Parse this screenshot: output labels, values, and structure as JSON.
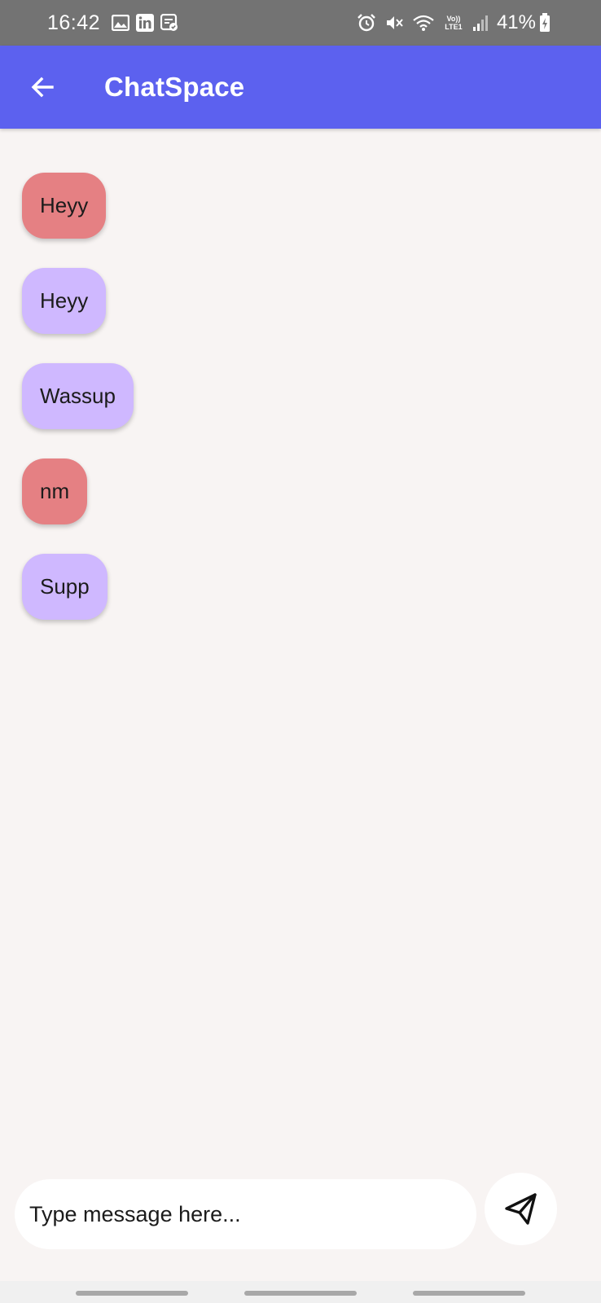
{
  "status_bar": {
    "time": "16:42",
    "battery_percent": "41%",
    "left_icons": [
      "gallery-icon",
      "linkedin-icon",
      "notification-app-icon"
    ],
    "right_icons": [
      "alarm-icon",
      "mute-icon",
      "wifi-icon",
      "volte-icon",
      "signal-icon",
      "battery-charging-icon"
    ]
  },
  "app_bar": {
    "title": "ChatSpace",
    "color": "#5c61ef"
  },
  "messages": [
    {
      "text": "Heyy",
      "type": "received",
      "color": "#e58083"
    },
    {
      "text": "Heyy",
      "type": "sent",
      "color": "#cfb8ff"
    },
    {
      "text": "Wassup",
      "type": "sent",
      "color": "#cfb8ff"
    },
    {
      "text": "nm",
      "type": "received",
      "color": "#e58083"
    },
    {
      "text": "Supp",
      "type": "sent",
      "color": "#cfb8ff"
    }
  ],
  "composer": {
    "placeholder": "Type message here...",
    "value": "",
    "send_icon": "send-icon"
  },
  "status_bar_extra": {
    "volte_text": "Vo)) LTE1"
  }
}
